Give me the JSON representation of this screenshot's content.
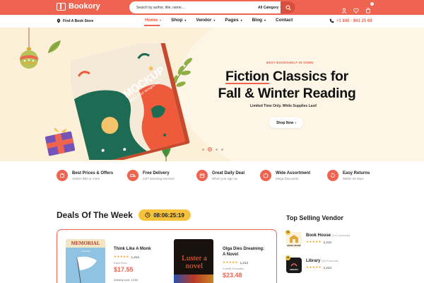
{
  "header": {
    "brand": "Bookory",
    "search": {
      "placeholder": "Search by author, title, name....",
      "category": "All Category"
    },
    "cart_count": "0"
  },
  "nav": {
    "store_label": "Find A Book Store",
    "menu": [
      {
        "label": "Home",
        "active": true
      },
      {
        "label": "Shop"
      },
      {
        "label": "Vendor"
      },
      {
        "label": "Pages"
      },
      {
        "label": "Blog"
      },
      {
        "label": "Contact"
      }
    ],
    "phone": "+1 840 - 841 25 69"
  },
  "hero": {
    "tagline": "BEST BOOKSHELF IN TOWN",
    "title_line1_underlined": "Fiction",
    "title_line1_rest": " Classics for",
    "title_line2": "Fall & Winter Reading",
    "subtitle": "Limited Time Only. While Supplies Last!",
    "button": "Shop Now",
    "book_title": "MOCKUP",
    "book_subtitle": "Make your designs be",
    "slide_count": 4,
    "active_slide": 2
  },
  "features": [
    {
      "title": "Best Prices & Offers",
      "sub": "Orders $50 or more"
    },
    {
      "title": "Free Delivery",
      "sub": "24/7 amazing services"
    },
    {
      "title": "Great Daily Deal",
      "sub": "When you sign up"
    },
    {
      "title": "Wide Assortment",
      "sub": "Mega Discounts"
    },
    {
      "title": "Easy Returns",
      "sub": "Within 30 days"
    }
  ],
  "deals": {
    "title": "Deals Of The Week",
    "timer": "08:06:25:19",
    "items": [
      {
        "name": "Think Like A Monk",
        "stars": "★★★★★",
        "rating_count": "1,214",
        "author": "Kara Price",
        "price": "$17.55",
        "sold": "Already sold: 12/60",
        "cover_title": "MEMORIAL",
        "cover_sub": "A NOVEL"
      },
      {
        "name": "Olga Dies Dreaming: A Novel",
        "stars": "★★★★★",
        "rating_count": "1,214",
        "author": "Xochitl Gonzalez",
        "price": "$23.48",
        "cover_title": "Luster a novel"
      }
    ]
  },
  "vendors": {
    "title": "Top Selling Vendor",
    "items": [
      {
        "rank": "01",
        "name": "Book House",
        "count": "(117 products)",
        "stars": "★★★★★",
        "rating_count": "1,214",
        "logo_text": "BOOK HOUSE"
      },
      {
        "rank": "02",
        "name": "Library",
        "count": "(28 Products)",
        "stars": "★★★★★",
        "rating_count": "1,214",
        "logo_text": "LIBRARY"
      }
    ]
  },
  "colors": {
    "accent": "#ef6451",
    "hero_bg": "#fcf0d9",
    "timer": "#f7c23c",
    "star": "#f5a623"
  }
}
